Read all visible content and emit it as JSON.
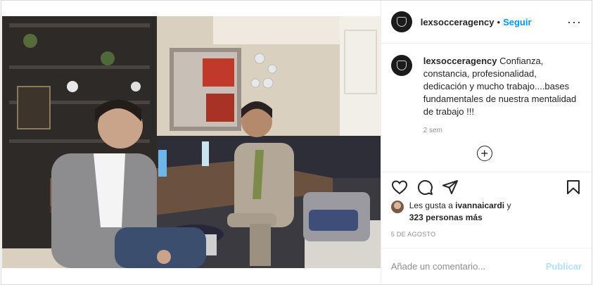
{
  "post": {
    "author": {
      "username": "lexsocceragency",
      "separator": "•",
      "follow_label": "Seguir",
      "more_icon": "more-horizontal-icon",
      "more_glyph": "···"
    },
    "caption": {
      "username": "lexsocceragency",
      "text": "Confianza, constancia, profesionalidad, dedicación y mucho trabajo....bases fundamentales de nuestra mentalidad de trabajo !!!",
      "time_ago": "2 sem"
    },
    "load_more_icon": "plus-circle-icon",
    "load_more_glyph": "+",
    "actions": {
      "icons": [
        "heart-icon",
        "comment-icon",
        "share-icon",
        "bookmark-icon"
      ]
    },
    "likes": {
      "prefix": "Les gusta a",
      "first_user": "ivannaicardi",
      "connector": "y",
      "others": "323 personas más"
    },
    "date": "5 DE AGOSTO",
    "comment": {
      "placeholder": "Añade un comentario...",
      "publish_label": "Publicar",
      "publish_color": "#b2dffc"
    }
  },
  "colors": {
    "follow": "#0095f6",
    "muted": "#8e8e8e",
    "text": "#262626"
  }
}
